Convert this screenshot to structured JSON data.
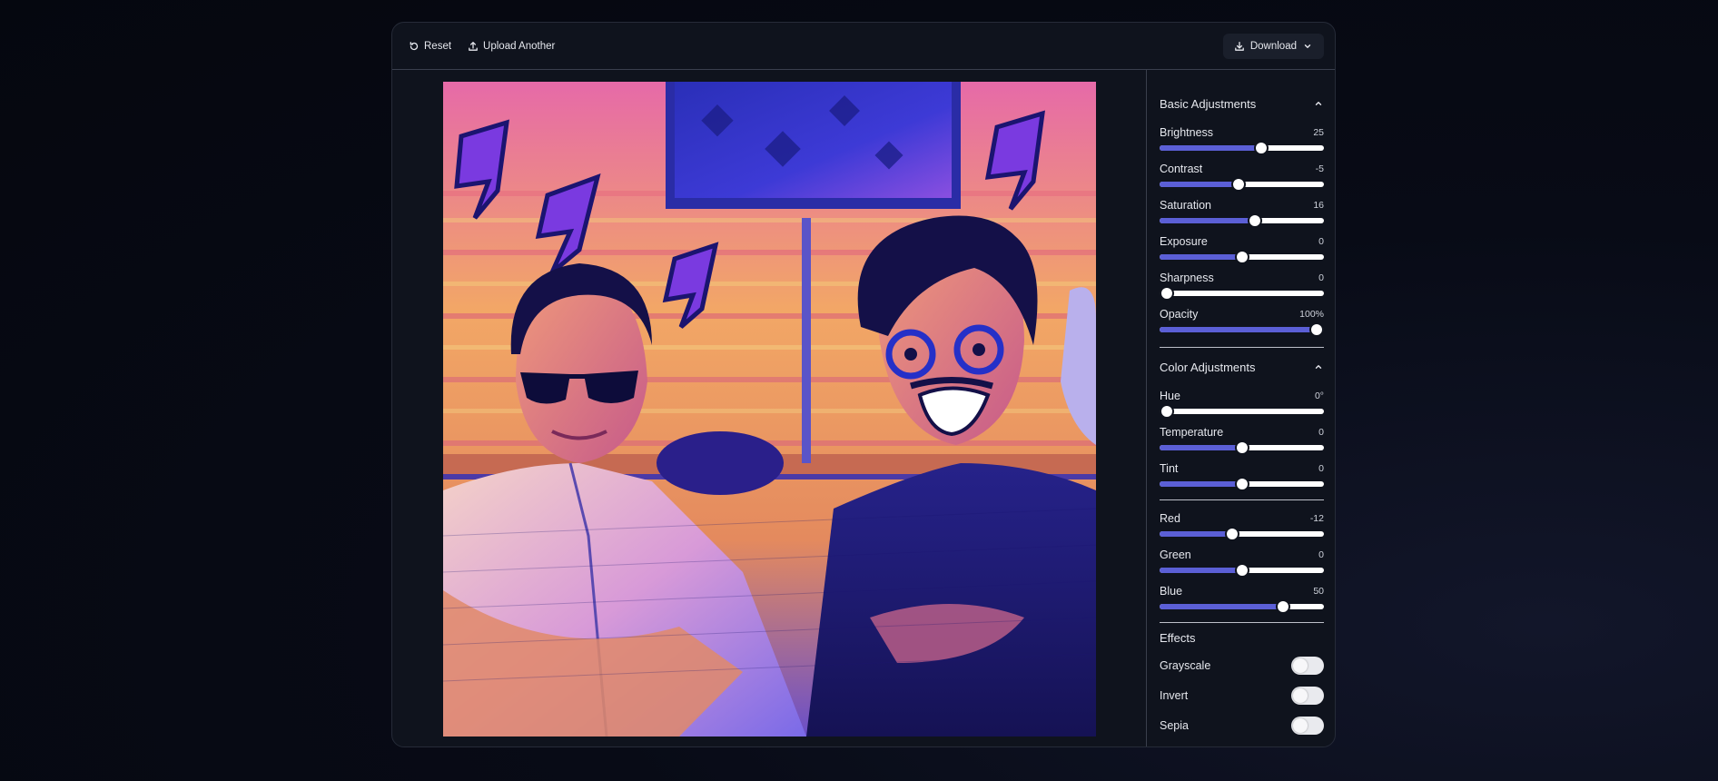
{
  "toolbar": {
    "reset_label": "Reset",
    "upload_label": "Upload Another",
    "download_label": "Download"
  },
  "panel": {
    "basic": {
      "title": "Basic Adjustments",
      "sliders": [
        {
          "label": "Brightness",
          "value": "25",
          "fraction": 0.62
        },
        {
          "label": "Contrast",
          "value": "-5",
          "fraction": 0.48
        },
        {
          "label": "Saturation",
          "value": "16",
          "fraction": 0.58
        },
        {
          "label": "Exposure",
          "value": "0",
          "fraction": 0.5
        },
        {
          "label": "Sharpness",
          "value": "0",
          "fraction": 0.0
        },
        {
          "label": "Opacity",
          "value": "100%",
          "fraction": 1.0
        }
      ]
    },
    "color": {
      "title": "Color Adjustments",
      "sliders": [
        {
          "label": "Hue",
          "value": "0°",
          "fraction": 0.0
        },
        {
          "label": "Temperature",
          "value": "0",
          "fraction": 0.5
        },
        {
          "label": "Tint",
          "value": "0",
          "fraction": 0.5
        }
      ]
    },
    "rgb": {
      "sliders": [
        {
          "label": "Red",
          "value": "-12",
          "fraction": 0.44
        },
        {
          "label": "Green",
          "value": "0",
          "fraction": 0.5
        },
        {
          "label": "Blue",
          "value": "50",
          "fraction": 0.75
        }
      ]
    },
    "effects": {
      "title": "Effects",
      "toggles": [
        {
          "label": "Grayscale",
          "on": false
        },
        {
          "label": "Invert",
          "on": false
        },
        {
          "label": "Sepia",
          "on": false
        }
      ]
    }
  },
  "colors": {
    "accent": "#5b5fd6",
    "background": "#0f131d"
  },
  "icons": {
    "reset": "rotate-ccw-icon",
    "upload": "upload-icon",
    "download": "download-icon",
    "chevron_down": "chevron-down-icon",
    "chevron_up": "chevron-up-icon"
  }
}
